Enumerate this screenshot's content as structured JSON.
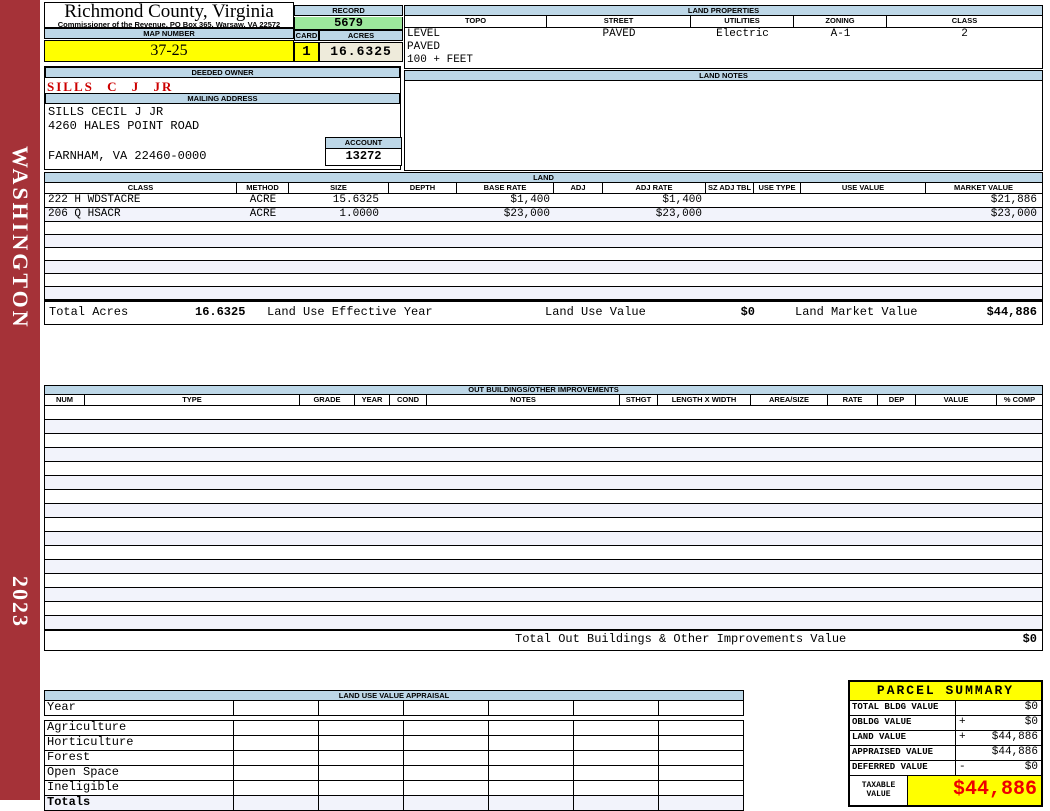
{
  "colors": {
    "sidebar_red": "#A53238",
    "header_blue": "#BDD7E7",
    "record_green": "#9CE89C",
    "highlight_yellow": "#FFFF00",
    "acres_cream": "#EEEBDB",
    "alert_red": "#CC0000"
  },
  "sidebar": {
    "watermark": "WASHINGTON",
    "year": "2023"
  },
  "header": {
    "title": "Richmond County, Virginia",
    "subtitle": "Commissioner of the Revenue, PO Box 365, Warsaw, VA 22572",
    "map_number_label": "MAP NUMBER",
    "map_number": "37-25",
    "record_label": "RECORD",
    "record": "5679",
    "card_label": "CARD",
    "card": "1",
    "acres_label": "ACRES",
    "acres": "16.6325"
  },
  "owner": {
    "deeded_owner_label": "DEEDED OWNER",
    "deeded_owner": "SILLS C J JR",
    "mailing_address_label": "MAILING ADDRESS",
    "address_line1": "SILLS CECIL J JR",
    "address_line2": "4260 HALES POINT ROAD",
    "address_line3": "FARNHAM, VA 22460-0000",
    "account_label": "ACCOUNT",
    "account": "13272"
  },
  "land_properties": {
    "title": "LAND PROPERTIES",
    "columns": [
      "TOPO",
      "STREET",
      "UTILITIES",
      "ZONING",
      "CLASS"
    ],
    "values": [
      "LEVEL",
      "PAVED",
      "Electric",
      "A-1",
      "2"
    ],
    "topo_extra": [
      "PAVED",
      "100 + FEET"
    ]
  },
  "land_notes": {
    "title": "LAND NOTES"
  },
  "land": {
    "title": "LAND",
    "columns": [
      "CLASS",
      "METHOD",
      "SIZE",
      "DEPTH",
      "BASE RATE",
      "ADJ",
      "ADJ RATE",
      "SZ ADJ TBL",
      "USE TYPE",
      "USE VALUE",
      "MARKET VALUE"
    ],
    "rows": [
      [
        "222 H WDSTACRE",
        "ACRE",
        "15.6325",
        "",
        "$1,400",
        "",
        "$1,400",
        "",
        "",
        "",
        "$21,886"
      ],
      [
        "206 Q HSACR",
        "ACRE",
        "1.0000",
        "",
        "$23,000",
        "",
        "$23,000",
        "",
        "",
        "",
        "$23,000"
      ]
    ],
    "totals": {
      "total_acres_label": "Total Acres",
      "total_acres": "16.6325",
      "effective_year_label": "Land Use Effective Year",
      "use_value_label": "Land Use Value",
      "use_value": "$0",
      "market_value_label": "Land Market Value",
      "market_value": "$44,886"
    }
  },
  "out_buildings": {
    "title": "OUT BUILDINGS/OTHER IMPROVEMENTS",
    "columns": [
      "NUM",
      "TYPE",
      "GRADE",
      "YEAR",
      "COND",
      "NOTES",
      "STHGT",
      "LENGTH X WIDTH",
      "AREA/SIZE",
      "RATE",
      "DEP",
      "VALUE",
      "% COMP"
    ],
    "total_label": "Total Out Buildings & Other Improvements Value",
    "total_value": "$0"
  },
  "land_use_appraisal": {
    "title": "LAND USE VALUE APPRAISAL",
    "row_labels": [
      "Year",
      "Agriculture",
      "Horticulture",
      "Forest",
      "Open Space",
      "Ineligible",
      "Totals"
    ]
  },
  "parcel_summary": {
    "title": "PARCEL SUMMARY",
    "rows": [
      {
        "label": "TOTAL BLDG VALUE",
        "op": "",
        "value": "$0"
      },
      {
        "label": "OBLDG VALUE",
        "op": "+",
        "value": "$0"
      },
      {
        "label": "LAND VALUE",
        "op": "+",
        "value": "$44,886"
      },
      {
        "label": "APPRAISED VALUE",
        "op": "",
        "value": "$44,886"
      },
      {
        "label": "DEFERRED VALUE",
        "op": "-",
        "value": "$0"
      }
    ],
    "taxable_label": "TAXABLE VALUE",
    "taxable_value": "$44,886"
  }
}
